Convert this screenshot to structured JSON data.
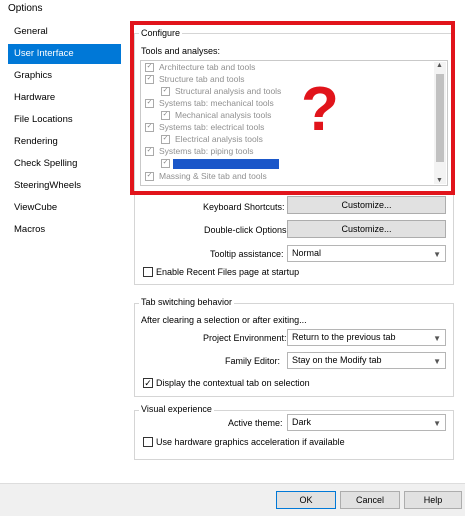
{
  "window": {
    "title": "Options"
  },
  "nav": {
    "items": [
      {
        "label": "General"
      },
      {
        "label": "User Interface",
        "selected": true
      },
      {
        "label": "Graphics"
      },
      {
        "label": "Hardware"
      },
      {
        "label": "File Locations"
      },
      {
        "label": "Rendering"
      },
      {
        "label": "Check Spelling"
      },
      {
        "label": "SteeringWheels"
      },
      {
        "label": "ViewCube"
      },
      {
        "label": "Macros"
      }
    ]
  },
  "configure": {
    "legend": "Configure",
    "tools_label": "Tools and analyses:",
    "tree": [
      {
        "label": "Architecture tab and tools",
        "checked": true,
        "level": 0
      },
      {
        "label": "Structure tab and tools",
        "checked": true,
        "level": 0
      },
      {
        "label": "Structural analysis and tools",
        "checked": true,
        "level": 1
      },
      {
        "label": "Systems tab: mechanical tools",
        "checked": true,
        "level": 0
      },
      {
        "label": "Mechanical analysis tools",
        "checked": true,
        "level": 1
      },
      {
        "label": "Systems tab: electrical tools",
        "checked": true,
        "level": 0
      },
      {
        "label": "Electrical analysis tools",
        "checked": true,
        "level": 1
      },
      {
        "label": "Systems tab: piping tools",
        "checked": true,
        "level": 0
      },
      {
        "label": "",
        "checked": true,
        "level": 1,
        "highlighted": true
      },
      {
        "label": "Massing & Site tab and tools",
        "checked": true,
        "level": 0
      }
    ],
    "keyboard_label": "Keyboard Shortcuts:",
    "keyboard_btn": "Customize...",
    "doubleclick_label": "Double-click Options:",
    "doubleclick_btn": "Customize...",
    "tooltip_label": "Tooltip assistance:",
    "tooltip_value": "Normal",
    "recent_files_label": "Enable Recent Files page at startup",
    "recent_files_checked": false
  },
  "tab_switching": {
    "legend": "Tab switching behavior",
    "after_label": "After clearing a selection or after exiting...",
    "project_label": "Project Environment:",
    "project_value": "Return to the previous tab",
    "family_label": "Family Editor:",
    "family_value": "Stay on the Modify tab",
    "contextual_label": "Display the contextual tab on selection",
    "contextual_checked": true
  },
  "visual": {
    "legend": "Visual experience",
    "theme_label": "Active theme:",
    "theme_value": "Dark",
    "hwaccel_label": "Use hardware graphics acceleration if available",
    "hwaccel_checked": false
  },
  "annotation": {
    "mark": "?",
    "color": "#e1141b"
  },
  "footer": {
    "ok": "OK",
    "cancel": "Cancel",
    "help": "Help"
  },
  "colors": {
    "selection": "#0078d7",
    "highlight": "#1b57c9"
  }
}
